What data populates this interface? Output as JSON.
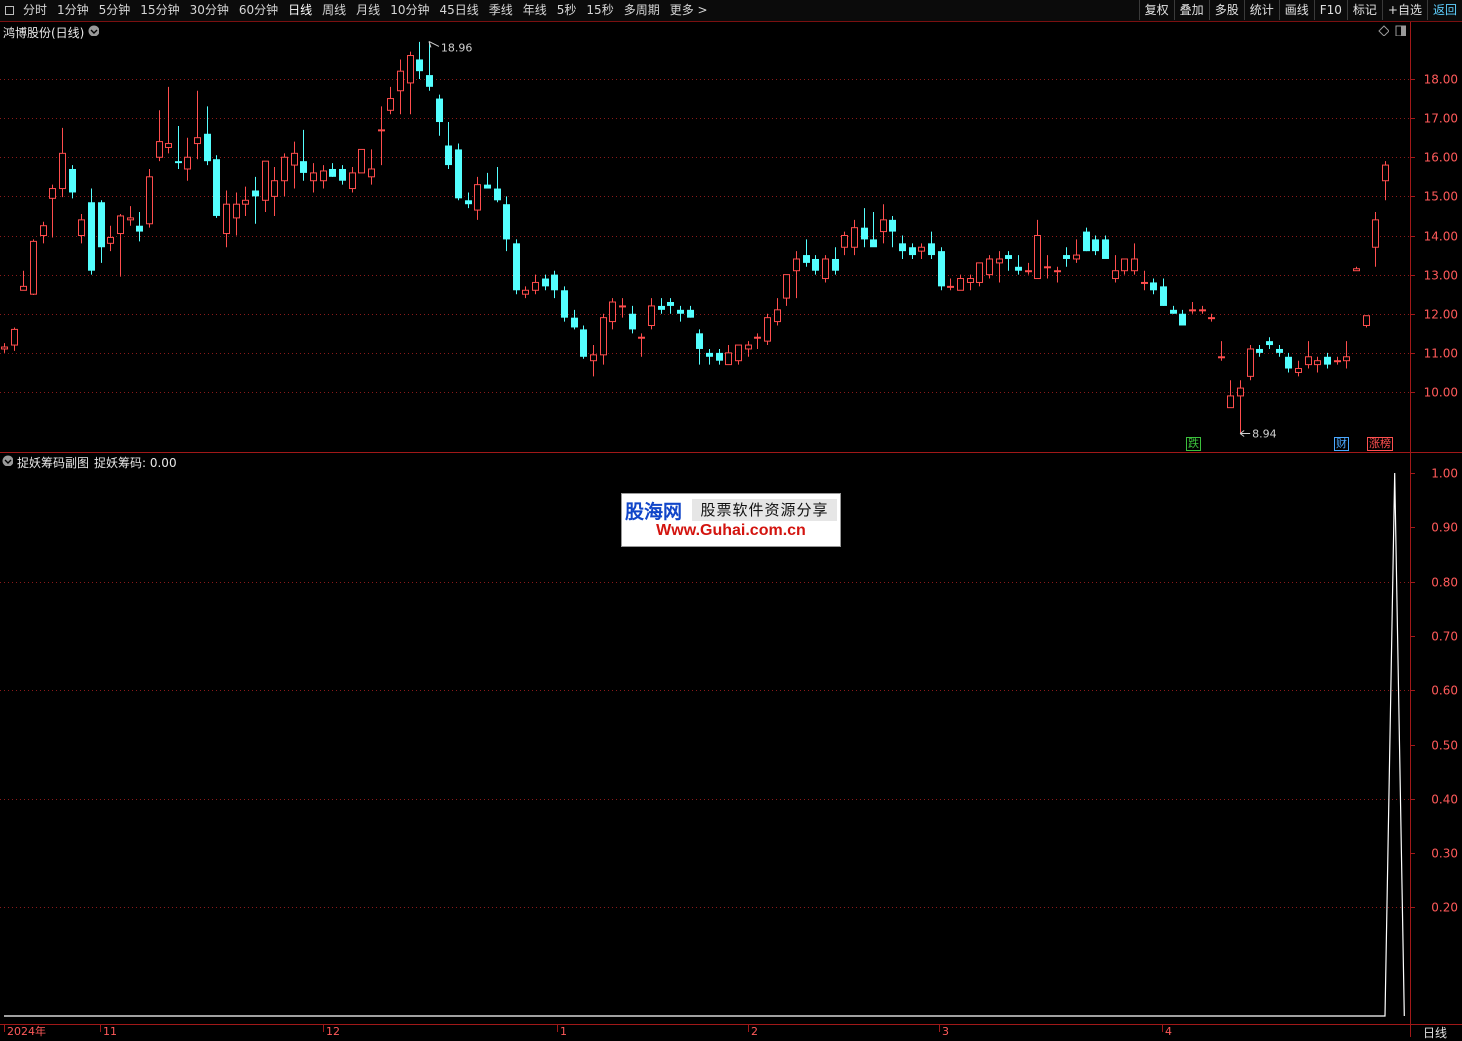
{
  "toolbar": {
    "periods": [
      "分时",
      "1分钟",
      "5分钟",
      "15分钟",
      "30分钟",
      "60分钟",
      "日线",
      "周线",
      "月线",
      "10分钟",
      "45日线",
      "季线",
      "年线",
      "5秒",
      "15秒",
      "多周期",
      "更多 >"
    ],
    "active_period": "日线",
    "actions": [
      "复权",
      "叠加",
      "多股",
      "统计",
      "画线",
      "F10",
      "标记",
      "+自选",
      "返回"
    ]
  },
  "main_chart": {
    "title": "鸿博股份(日线)",
    "price_axis": [
      "18.00",
      "17.00",
      "16.00",
      "15.00",
      "14.00",
      "13.00",
      "12.00",
      "11.00",
      "10.00"
    ],
    "high_label": "18.96",
    "low_label": "8.94",
    "badges": [
      {
        "text": "跌",
        "color": "#3cc03c"
      },
      {
        "text": "财",
        "color": "#4aa8ff"
      },
      {
        "text": "涨榜",
        "color": "#ff5050"
      }
    ]
  },
  "indicator": {
    "title": "捉妖筹码副图",
    "value_label": "捉妖筹码: 0.00",
    "axis": [
      "1.00",
      "0.90",
      "0.80",
      "0.70",
      "0.60",
      "0.50",
      "0.40",
      "0.30",
      "0.20"
    ]
  },
  "date_axis": [
    "2024年",
    "11",
    "12",
    "1",
    "2",
    "3",
    "4"
  ],
  "period_indicator": "日线",
  "watermark": {
    "brand": "股海网",
    "tagline": "股票软件资源分享",
    "url": "Www.Guhai.com.cn"
  },
  "colors": {
    "up": "#ff4d4d",
    "down": "#54ffff",
    "grid": "#8a1a1a",
    "axis_text": "#ff5a5a"
  },
  "chart_data": [
    {
      "type": "candlestick",
      "title": "鸿博股份(日线)",
      "ylim": [
        8.8,
        19.2
      ],
      "candles": [
        [
          11.1,
          11.25,
          11.0,
          11.15
        ],
        [
          11.2,
          11.65,
          11.05,
          11.6
        ],
        [
          12.6,
          13.1,
          12.65,
          12.7
        ],
        [
          12.5,
          13.9,
          12.48,
          13.85
        ],
        [
          14.0,
          14.35,
          13.8,
          14.25
        ],
        [
          14.95,
          15.3,
          13.95,
          15.2
        ],
        [
          15.2,
          16.75,
          14.98,
          16.1
        ],
        [
          15.7,
          15.8,
          14.95,
          15.1
        ],
        [
          14.0,
          14.55,
          13.8,
          14.4
        ],
        [
          14.85,
          15.2,
          13.0,
          13.1
        ],
        [
          14.85,
          14.9,
          13.3,
          13.7
        ],
        [
          13.8,
          14.25,
          13.6,
          13.95
        ],
        [
          14.05,
          14.55,
          12.95,
          14.5
        ],
        [
          14.4,
          14.75,
          14.25,
          14.45
        ],
        [
          14.25,
          14.6,
          13.85,
          14.1
        ],
        [
          14.3,
          15.7,
          14.2,
          15.5
        ],
        [
          16.0,
          17.2,
          15.9,
          16.4
        ],
        [
          16.25,
          17.8,
          16.1,
          16.35
        ],
        [
          15.9,
          16.8,
          15.7,
          15.85
        ],
        [
          15.7,
          16.5,
          15.4,
          16.0
        ],
        [
          16.35,
          17.7,
          15.95,
          16.5
        ],
        [
          16.6,
          17.3,
          15.8,
          15.9
        ],
        [
          15.95,
          16.05,
          14.45,
          14.5
        ],
        [
          14.05,
          15.15,
          13.7,
          14.8
        ],
        [
          14.45,
          15.1,
          14.0,
          14.8
        ],
        [
          14.8,
          15.25,
          14.5,
          14.9
        ],
        [
          15.15,
          15.5,
          14.3,
          15.0
        ],
        [
          14.9,
          15.8,
          14.6,
          15.9
        ],
        [
          15.0,
          15.75,
          14.5,
          15.4
        ],
        [
          15.4,
          16.1,
          15.0,
          16.0
        ],
        [
          15.8,
          16.4,
          15.2,
          16.1
        ],
        [
          15.9,
          16.7,
          15.4,
          15.6
        ],
        [
          15.4,
          15.85,
          15.1,
          15.6
        ],
        [
          15.4,
          15.8,
          15.2,
          15.65
        ],
        [
          15.7,
          15.85,
          15.5,
          15.5
        ],
        [
          15.7,
          15.8,
          15.3,
          15.4
        ],
        [
          15.2,
          15.75,
          15.1,
          15.6
        ],
        [
          15.6,
          16.1,
          15.6,
          16.2
        ],
        [
          15.5,
          16.2,
          15.3,
          15.7
        ],
        [
          16.7,
          17.3,
          15.8,
          16.7
        ],
        [
          17.2,
          17.8,
          17.1,
          17.5
        ],
        [
          17.7,
          18.5,
          17.1,
          18.2
        ],
        [
          17.9,
          18.7,
          17.1,
          18.6
        ],
        [
          18.5,
          18.95,
          18.0,
          18.2
        ],
        [
          18.1,
          18.96,
          17.7,
          17.8
        ],
        [
          17.5,
          17.6,
          16.55,
          16.9
        ],
        [
          16.3,
          16.9,
          15.7,
          15.8
        ],
        [
          16.2,
          16.35,
          14.9,
          14.95
        ],
        [
          14.9,
          15.1,
          14.7,
          14.8
        ],
        [
          14.65,
          15.5,
          14.4,
          15.3
        ],
        [
          15.3,
          15.6,
          15.2,
          15.2
        ],
        [
          15.2,
          15.75,
          14.85,
          14.9
        ],
        [
          14.8,
          15.0,
          13.6,
          13.9
        ],
        [
          13.8,
          13.9,
          12.5,
          12.6
        ],
        [
          12.5,
          12.7,
          12.4,
          12.6
        ],
        [
          12.6,
          13.0,
          12.5,
          12.8
        ],
        [
          12.9,
          13.0,
          12.6,
          12.7
        ],
        [
          13.0,
          13.1,
          12.4,
          12.6
        ],
        [
          12.6,
          12.7,
          11.8,
          11.9
        ],
        [
          11.9,
          12.1,
          11.6,
          11.65
        ],
        [
          11.6,
          11.7,
          10.85,
          10.9
        ],
        [
          10.8,
          11.2,
          10.4,
          10.95
        ],
        [
          10.95,
          12.0,
          10.7,
          11.9
        ],
        [
          11.8,
          12.4,
          11.6,
          12.3
        ],
        [
          12.2,
          12.4,
          11.9,
          12.2
        ],
        [
          12.0,
          12.2,
          11.5,
          11.6
        ],
        [
          11.4,
          11.5,
          10.9,
          11.4
        ],
        [
          11.7,
          12.4,
          11.6,
          12.2
        ],
        [
          12.2,
          12.4,
          12.0,
          12.1
        ],
        [
          12.3,
          12.4,
          12.0,
          12.2
        ],
        [
          12.1,
          12.2,
          11.8,
          12.0
        ],
        [
          12.1,
          12.2,
          11.9,
          11.9
        ],
        [
          11.5,
          11.6,
          10.7,
          11.1
        ],
        [
          11.0,
          11.1,
          10.7,
          10.9
        ],
        [
          11.0,
          11.1,
          10.7,
          10.8
        ],
        [
          10.7,
          11.2,
          10.7,
          11.0
        ],
        [
          10.8,
          11.1,
          10.7,
          11.2
        ],
        [
          11.1,
          11.3,
          10.9,
          11.2
        ],
        [
          11.4,
          11.5,
          11.1,
          11.4
        ],
        [
          11.3,
          12.0,
          11.2,
          11.9
        ],
        [
          11.8,
          12.4,
          11.7,
          12.1
        ],
        [
          12.4,
          13.0,
          12.2,
          13.0
        ],
        [
          13.1,
          13.6,
          12.4,
          13.4
        ],
        [
          13.5,
          13.9,
          13.2,
          13.3
        ],
        [
          13.4,
          13.5,
          13.0,
          13.1
        ],
        [
          12.9,
          13.5,
          12.8,
          13.4
        ],
        [
          13.4,
          13.7,
          13.0,
          13.1
        ],
        [
          13.7,
          14.1,
          13.5,
          14.0
        ],
        [
          13.7,
          14.4,
          13.5,
          14.2
        ],
        [
          14.2,
          14.7,
          13.7,
          13.9
        ],
        [
          13.9,
          14.6,
          13.8,
          13.7
        ],
        [
          14.1,
          14.8,
          13.8,
          14.4
        ],
        [
          14.4,
          14.5,
          13.7,
          14.1
        ],
        [
          13.8,
          14.0,
          13.4,
          13.6
        ],
        [
          13.7,
          13.8,
          13.4,
          13.5
        ],
        [
          13.6,
          13.8,
          13.4,
          13.7
        ],
        [
          13.8,
          14.1,
          13.4,
          13.5
        ],
        [
          13.6,
          13.7,
          12.6,
          12.7
        ],
        [
          12.7,
          12.9,
          12.6,
          12.7
        ],
        [
          12.6,
          13.0,
          12.6,
          12.9
        ],
        [
          12.8,
          13.0,
          12.6,
          12.9
        ],
        [
          12.8,
          13.2,
          12.7,
          13.3
        ],
        [
          13.0,
          13.5,
          12.9,
          13.4
        ],
        [
          13.3,
          13.6,
          12.8,
          13.4
        ],
        [
          13.5,
          13.6,
          13.1,
          13.4
        ],
        [
          13.2,
          13.5,
          13.0,
          13.1
        ],
        [
          13.1,
          13.3,
          13.0,
          13.1
        ],
        [
          12.9,
          14.4,
          12.9,
          14.0
        ],
        [
          13.2,
          13.5,
          12.9,
          13.2
        ],
        [
          13.1,
          13.2,
          12.8,
          13.1
        ],
        [
          13.5,
          13.7,
          13.2,
          13.4
        ],
        [
          13.4,
          13.9,
          13.3,
          13.5
        ],
        [
          14.1,
          14.2,
          13.6,
          13.6
        ],
        [
          13.9,
          14.0,
          13.5,
          13.6
        ],
        [
          13.9,
          14.0,
          13.5,
          13.4
        ],
        [
          12.9,
          13.5,
          12.8,
          13.1
        ],
        [
          13.1,
          13.4,
          13.0,
          13.4
        ],
        [
          13.1,
          13.8,
          13.0,
          13.4
        ],
        [
          12.8,
          13.1,
          12.6,
          12.8
        ],
        [
          12.8,
          12.9,
          12.5,
          12.6
        ],
        [
          12.7,
          12.9,
          12.2,
          12.2
        ],
        [
          12.1,
          12.2,
          12.0,
          12.0
        ],
        [
          12.0,
          12.1,
          11.8,
          11.7
        ],
        [
          12.1,
          12.3,
          12.0,
          12.1
        ],
        [
          12.1,
          12.2,
          12.0,
          12.1
        ],
        [
          11.9,
          12.0,
          11.8,
          11.9
        ],
        [
          10.9,
          11.3,
          10.8,
          10.9
        ],
        [
          9.6,
          10.3,
          9.6,
          9.9
        ],
        [
          9.9,
          10.3,
          8.94,
          10.1
        ],
        [
          10.4,
          11.2,
          10.3,
          11.1
        ],
        [
          11.1,
          11.2,
          10.9,
          11.0
        ],
        [
          11.3,
          11.4,
          11.1,
          11.2
        ],
        [
          11.1,
          11.2,
          10.9,
          11.0
        ],
        [
          10.9,
          11.0,
          10.5,
          10.6
        ],
        [
          10.5,
          10.8,
          10.4,
          10.6
        ],
        [
          10.7,
          11.3,
          10.6,
          10.9
        ],
        [
          10.7,
          10.9,
          10.5,
          10.8
        ],
        [
          10.9,
          11.0,
          10.6,
          10.7
        ],
        [
          10.8,
          10.9,
          10.7,
          10.8
        ],
        [
          10.8,
          11.3,
          10.6,
          10.9
        ],
        [
          13.1,
          13.2,
          13.1,
          13.15
        ],
        [
          11.7,
          11.95,
          11.65,
          11.95
        ],
        [
          13.7,
          14.6,
          13.2,
          14.4
        ],
        [
          15.4,
          15.9,
          14.9,
          15.8
        ]
      ]
    },
    {
      "type": "line",
      "title": "捉妖筹码副图",
      "series": [
        {
          "name": "捉妖筹码",
          "values": [
            0,
            0,
            0,
            0,
            0,
            0,
            0,
            0,
            0,
            0,
            0,
            0,
            0,
            0,
            0,
            0,
            0,
            0,
            0,
            0,
            0,
            0,
            0,
            0,
            0,
            0,
            0,
            0,
            0,
            0,
            0,
            0,
            0,
            0,
            0,
            0,
            0,
            0,
            0,
            0,
            0,
            0,
            0,
            0,
            0,
            0,
            0,
            0,
            0,
            0,
            0,
            0,
            0,
            0,
            0,
            0,
            0,
            0,
            0,
            0,
            0,
            0,
            0,
            0,
            0,
            0,
            0,
            0,
            0,
            0,
            0,
            0,
            0,
            0,
            0,
            0,
            0,
            0,
            0,
            0,
            0,
            0,
            0,
            0,
            0,
            0,
            0,
            0,
            0,
            0,
            0,
            0,
            0,
            0,
            0,
            0,
            0,
            0,
            0,
            0,
            0,
            0,
            0,
            0,
            0,
            0,
            0,
            0,
            0,
            0,
            0,
            0,
            0,
            0,
            0,
            0,
            0,
            0,
            0,
            0,
            0,
            0,
            0,
            0,
            0,
            0,
            0,
            0,
            0,
            0,
            0,
            0,
            0,
            0,
            0,
            0,
            0,
            0,
            0,
            0,
            0,
            0,
            0,
            0,
            1,
            0
          ]
        }
      ],
      "ylim": [
        0,
        1
      ]
    }
  ]
}
